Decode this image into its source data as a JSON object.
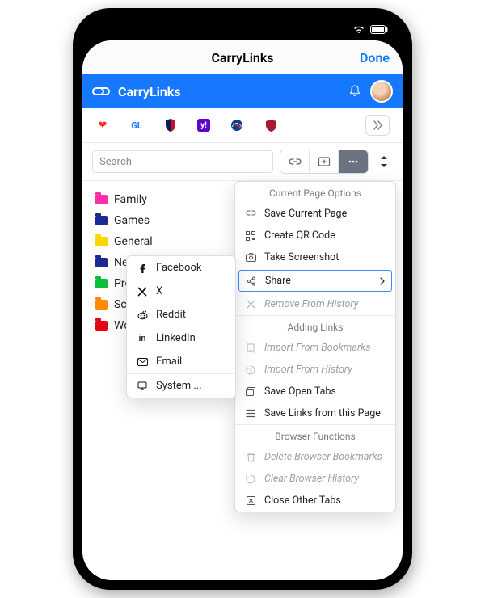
{
  "nav": {
    "title": "CarryLinks",
    "done": "Done"
  },
  "app": {
    "title": "CarryLinks"
  },
  "favorites": [
    "heart",
    "gl",
    "nfl",
    "yahoo",
    "nasa",
    "harvard"
  ],
  "search": {
    "placeholder": "Search"
  },
  "folders": [
    {
      "name": "Family",
      "color": "#ff2ea6"
    },
    {
      "name": "Games",
      "color": "#1a2a90"
    },
    {
      "name": "General",
      "color": "#ffd600"
    },
    {
      "name": "News",
      "color": "#1a2a90"
    },
    {
      "name": "Products",
      "color": "#0bbf3a"
    },
    {
      "name": "School",
      "color": "#ff8a00"
    },
    {
      "name": "Work",
      "color": "#e30613"
    }
  ],
  "menu": {
    "s1_title": "Current Page Options",
    "save": "Save Current Page",
    "qr": "Create QR Code",
    "shot": "Take Screenshot",
    "share": "Share",
    "remhist": "Remove From History",
    "s2_title": "Adding Links",
    "impbm": "Import From Bookmarks",
    "imphist": "Import From History",
    "opentabs": "Save Open Tabs",
    "pagelinks": "Save Links from this Page",
    "s3_title": "Browser Functions",
    "delbm": "Delete Browser Bookmarks",
    "clrhist": "Clear Browser History",
    "closetabs": "Close Other Tabs"
  },
  "share_menu": {
    "facebook": "Facebook",
    "x": "X",
    "reddit": "Reddit",
    "linkedin": "LinkedIn",
    "email": "Email",
    "system": "System ..."
  }
}
